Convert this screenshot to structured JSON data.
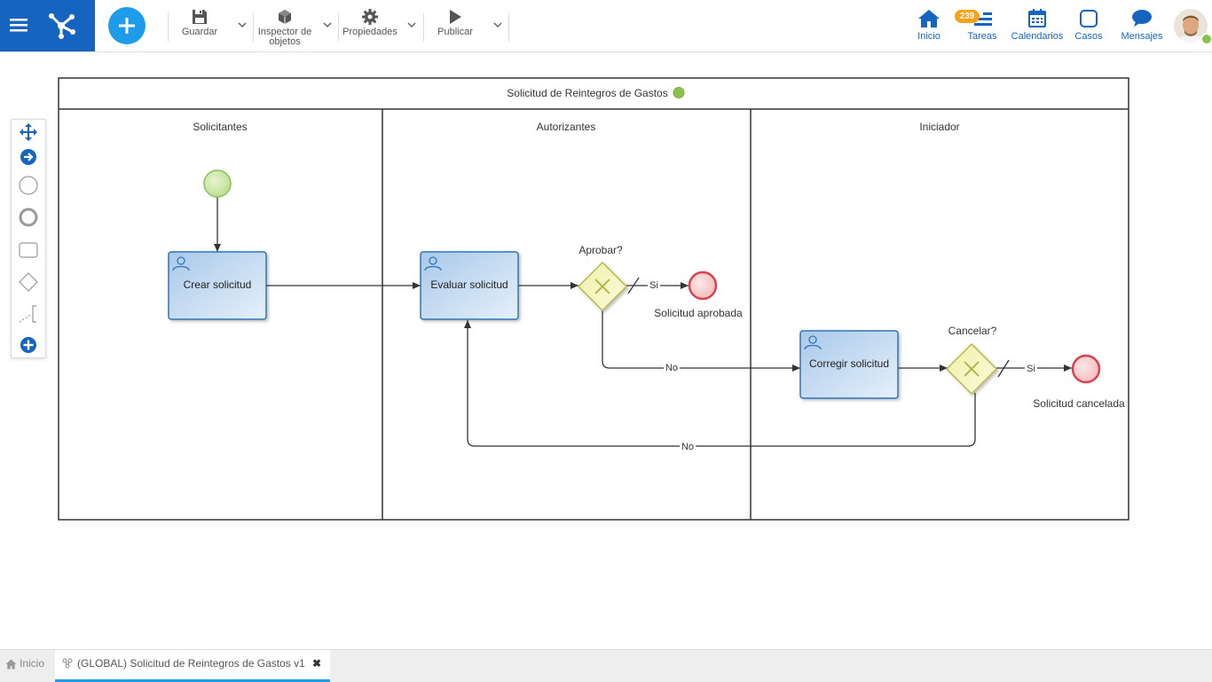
{
  "toolbar": {
    "save": "Guardar",
    "inspector_line1": "Inspector de",
    "inspector_line2": "objetos",
    "properties": "Propiedades",
    "publish": "Publicar"
  },
  "nav": {
    "home": "Inicio",
    "tasks": "Tareas",
    "tasks_badge": "239",
    "calendars": "Calendarios",
    "cases": "Casos",
    "messages": "Mensajes"
  },
  "diagram": {
    "pool_title": "Solicitud de Reintegros de Gastos",
    "lanes": [
      "Solicitantes",
      "Autorizantes",
      "Iniciador"
    ],
    "tasks": {
      "create": "Crear solicitud",
      "evaluate": "Evaluar solicitud",
      "correct": "Corregir solicitud"
    },
    "gateways": {
      "approve": "Aprobar?",
      "cancel": "Cancelar?"
    },
    "end_events": {
      "approved": "Solicitud aprobada",
      "canceled": "Solicitud cancelada"
    },
    "flow_labels": {
      "yes": "Si",
      "no": "No"
    }
  },
  "bottom_tabs": {
    "home": "Inicio",
    "process": "(GLOBAL) Solicitud de Reintegros de Gastos v1"
  },
  "colors": {
    "brand": "#1565c0",
    "accent": "#1e9be9",
    "task_fill": "#bcd6ee",
    "gateway_fill": "#f4f4b8",
    "start_fill": "#c8e6a0",
    "end_stroke": "#d9414c",
    "status_green": "#8bc34a"
  }
}
